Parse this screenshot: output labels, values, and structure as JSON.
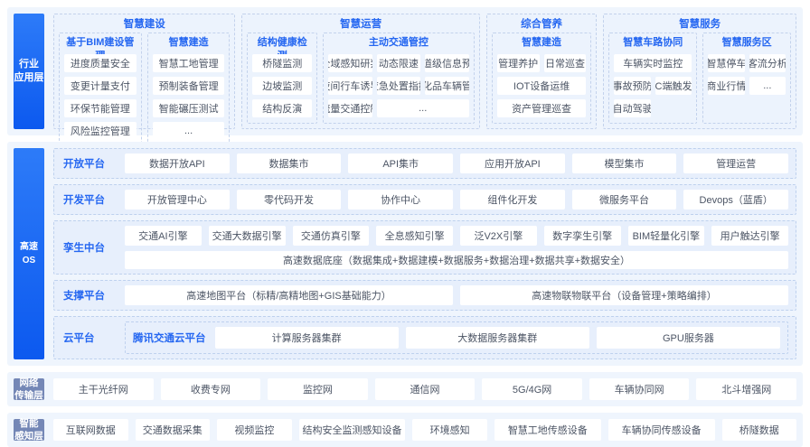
{
  "colors": {
    "accent_blue": "#2567f1",
    "label_blue": "#1667f2",
    "label_slate": "#7487b6",
    "band_bg": "#eff5fd",
    "row_bg": "#e7effc"
  },
  "layers": {
    "apps": {
      "label_line1": "行业",
      "label_line2": "应用层",
      "groups": [
        {
          "title": "智慧建设",
          "subgroups": [
            {
              "title": "基于BIM建设管理",
              "items": [
                "进度质量安全",
                "变更计量支付",
                "环保节能管理",
                "风险监控管理"
              ]
            },
            {
              "title": "智慧建造",
              "items": [
                "智慧工地管理",
                "预制装备管理",
                "智能碾压测试",
                "..."
              ]
            }
          ]
        },
        {
          "title": "智慧运营",
          "subgroups": [
            {
              "title": "结构健康检测",
              "items": [
                "桥隧监测",
                "边坡监测",
                "结构反演"
              ]
            },
            {
              "title": "主动交通管控",
              "items": [
                "全域感知研判",
                "动态限速",
                "车道级信息预判",
                "夜间行车诱导",
                "应急处置指挥",
                "危化品车辆管控",
                "流量交通控制",
                "..."
              ]
            }
          ]
        },
        {
          "title": "综合管养",
          "subgroups": [
            {
              "title": "智慧建造",
              "items": [
                "管理养护",
                "日常巡查",
                "IOT设备运维",
                "资产管理巡查"
              ]
            }
          ]
        },
        {
          "title": "智慧服务",
          "subgroups": [
            {
              "title": "智慧车路协同",
              "items": [
                "车辆实时监控",
                "事故预防",
                "C端触发",
                "自动驾驶"
              ]
            },
            {
              "title": "智慧服务区",
              "items": [
                "智慧停车",
                "客流分析",
                "商业行情",
                "..."
              ]
            }
          ]
        }
      ]
    },
    "os": {
      "label": "高速OS",
      "rows": [
        {
          "label": "开放平台",
          "items": [
            "数据开放API",
            "数据集市",
            "API集市",
            "应用开放API",
            "模型集市",
            "管理运营"
          ]
        },
        {
          "label": "开发平台",
          "items": [
            "开放管理中心",
            "零代码开发",
            "协作中心",
            "组件化开发",
            "微服务平台",
            "Devops（蓝盾）"
          ]
        },
        {
          "label": "孪生中台",
          "items": [
            "交通AI引擎",
            "交通大数据引擎",
            "交通仿真引擎",
            "全息感知引擎",
            "泛V2X引擎",
            "数字孪生引擎",
            "BIM轻量化引擎",
            "用户触达引擎"
          ],
          "bar": "高速数据底座（数据集成+数据建模+数据服务+数据治理+数据共享+数据安全）"
        },
        {
          "label": "支撑平台",
          "items": [
            "高速地图平台（标精/高精地图+GIS基础能力）",
            "高速物联物联平台（设备管理+策略编排）"
          ]
        },
        {
          "label": "云平台",
          "cloud_label": "腾讯交通云平台",
          "items": [
            "计算服务器集群",
            "大数据服务器集群",
            "GPU服务器"
          ]
        }
      ]
    },
    "network": {
      "label_line1": "网络",
      "label_line2": "传输层",
      "items": [
        "主干光纤网",
        "收费专网",
        "监控网",
        "通信网",
        "5G/4G网",
        "车辆协同网",
        "北斗增强网"
      ]
    },
    "sensing": {
      "label_line1": "智能",
      "label_line2": "感知层",
      "items": [
        "互联网数据",
        "交通数据采集",
        "视频监控",
        "结构安全监测感知设备",
        "环境感知",
        "智慧工地传感设备",
        "车辆协同传感设备",
        "桥隧数据"
      ]
    }
  }
}
